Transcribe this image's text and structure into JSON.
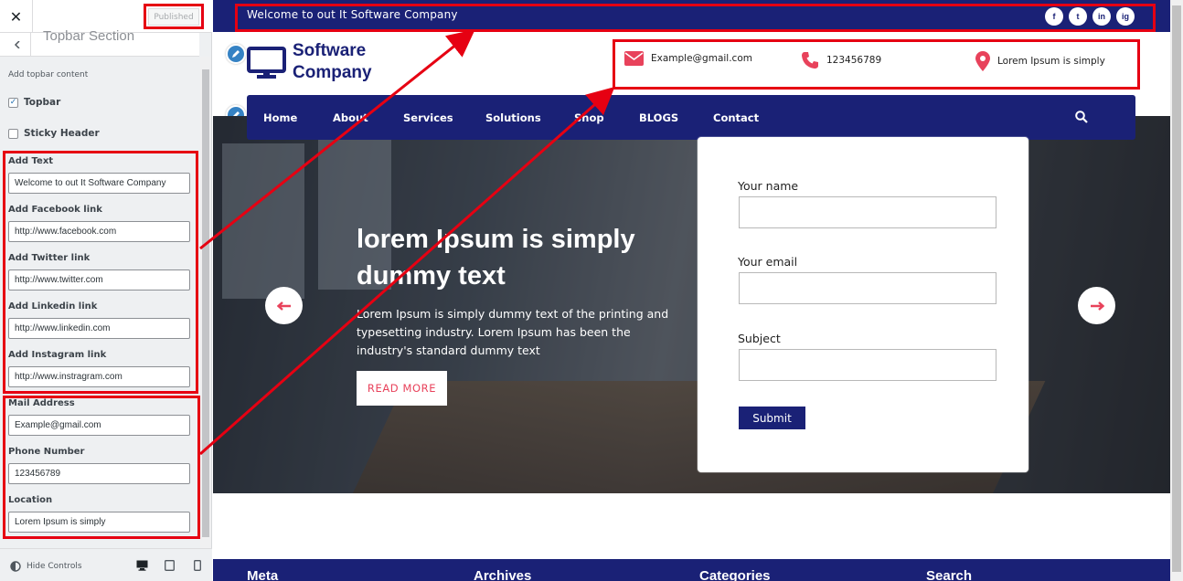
{
  "customizer": {
    "close_label": "✕",
    "published_label": "Published",
    "section_title": "Topbar Section",
    "description": "Add topbar content",
    "checkboxes": [
      {
        "label": "Topbar",
        "checked": true
      },
      {
        "label": "Sticky Header",
        "checked": false
      }
    ],
    "fields": [
      {
        "label": "Add Text",
        "value": "Welcome to out It Software Company"
      },
      {
        "label": "Add Facebook link",
        "value": "http://www.facebook.com"
      },
      {
        "label": "Add Twitter link",
        "value": "http://www.twitter.com"
      },
      {
        "label": "Add Linkedin link",
        "value": "http://www.linkedin.com"
      },
      {
        "label": "Add Instagram link",
        "value": "http://www.instragram.com"
      },
      {
        "label": "Mail Address",
        "value": "Example@gmail.com"
      },
      {
        "label": "Phone Number",
        "value": "123456789"
      },
      {
        "label": "Location",
        "value": "Lorem Ipsum is simply"
      }
    ],
    "hide_controls_label": "Hide Controls",
    "devices": [
      "desktop-icon",
      "tablet-icon",
      "mobile-icon"
    ]
  },
  "site": {
    "topbar_text": "Welcome to out It Software Company",
    "social": [
      "f",
      "t",
      "in",
      "ig"
    ],
    "logo_line1": "Software",
    "logo_line2": "Company",
    "email": "Example@gmail.com",
    "phone": "123456789",
    "location": "Lorem Ipsum is simply",
    "nav": [
      "Home",
      "About",
      "Services",
      "Solutions",
      "Shop",
      "BLOGS",
      "Contact"
    ],
    "hero_title": "lorem Ipsum is simply dummy text",
    "hero_text": "Lorem Ipsum is simply dummy text of the printing and typesetting industry. Lorem Ipsum has been the industry's standard dummy text",
    "read_more": "READ MORE",
    "form": {
      "name_label": "Your name",
      "email_label": "Your email",
      "subject_label": "Subject",
      "submit": "Submit"
    },
    "footer_headings": [
      "Meta",
      "Archives",
      "Categories",
      "Search"
    ]
  },
  "colors": {
    "brand": "#1a2176",
    "accent": "#e8425b",
    "highlight": "#e60012"
  }
}
